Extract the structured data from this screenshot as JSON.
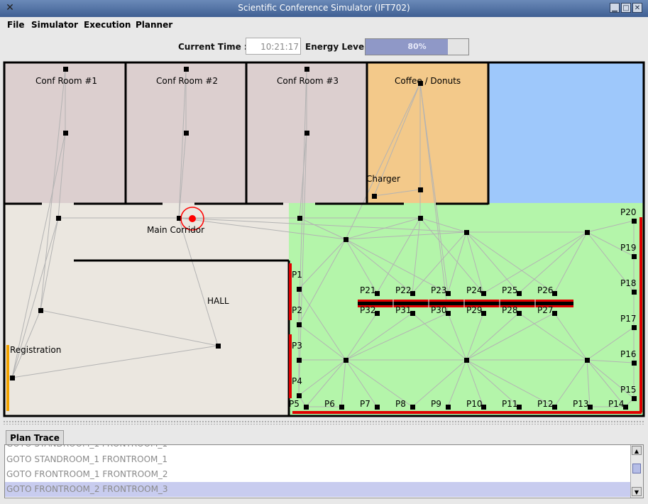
{
  "window": {
    "title": "Scientific Conference Simulator (IFT702)",
    "app_icon": "x-icon",
    "controls": [
      "minimize",
      "maximize",
      "close"
    ]
  },
  "menu": [
    "File",
    "Simulator",
    "Execution",
    "Planner"
  ],
  "status": {
    "time_label": "Current Time :",
    "time_value": "10:21:17",
    "energy_label": "Energy Level",
    "energy_text": "80%",
    "energy_level": 0.8,
    "energy_color": "#8f98c7"
  },
  "map": {
    "rooms": {
      "conf1": "Conf Room #1",
      "conf2": "Conf Room #2",
      "conf3": "Conf Room #3",
      "coffee": "Coffee / Donuts",
      "charger": "Charger",
      "corridor": "Main Corridor",
      "hall": "HALL",
      "registration": "Registration"
    },
    "poster_labels": [
      "P1",
      "P2",
      "P3",
      "P4",
      "P5",
      "P6",
      "P7",
      "P8",
      "P9",
      "P10",
      "P11",
      "P12",
      "P13",
      "P14",
      "P15",
      "P16",
      "P17",
      "P18",
      "P19",
      "P20",
      "P21",
      "P22",
      "P23",
      "P24",
      "P25",
      "P26",
      "P27",
      "P28",
      "P29",
      "P30",
      "P31",
      "P32"
    ],
    "colors": {
      "conf_room": "#dccfcf",
      "coffee": "#f3c98a",
      "sky": "#9ec8fb",
      "floor": "#ebe7e0",
      "exhibit": "#b4f5aa",
      "poster_wall": "#e00000",
      "robot": "#ff0000",
      "registration_desk": "#f2a300",
      "node": "#000000",
      "edge": "#b3b3b3"
    }
  },
  "plan_trace": {
    "tab_label": "Plan Trace",
    "lines": [
      "GOTO STANDROOM_1 FRONTROOM_1",
      "GOTO FRONTROOM_1 FRONTROOM_2",
      "GOTO FRONTROOM_2 FRONTROOM_3"
    ],
    "selected_index": 2
  }
}
